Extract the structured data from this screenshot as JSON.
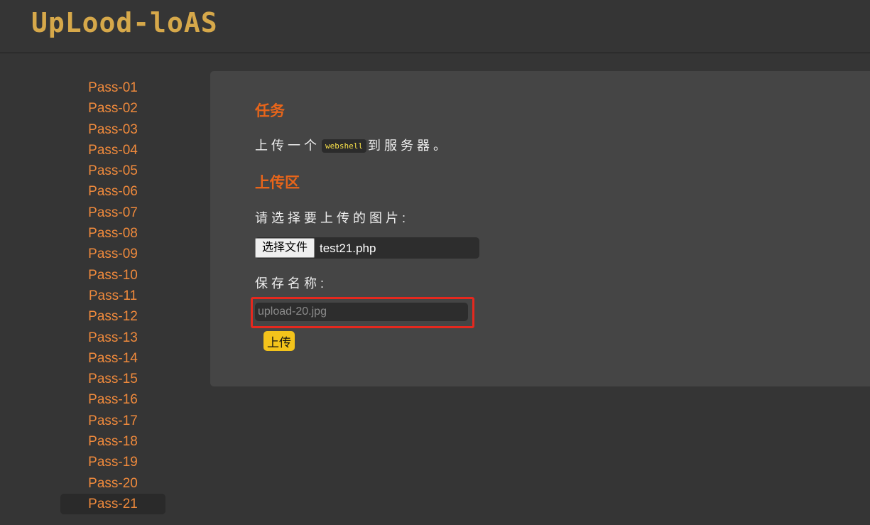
{
  "header": {
    "logo_text": "UpLood-loAS"
  },
  "sidebar": {
    "items": [
      {
        "label": "Pass-01"
      },
      {
        "label": "Pass-02"
      },
      {
        "label": "Pass-03"
      },
      {
        "label": "Pass-04"
      },
      {
        "label": "Pass-05"
      },
      {
        "label": "Pass-06"
      },
      {
        "label": "Pass-07"
      },
      {
        "label": "Pass-08"
      },
      {
        "label": "Pass-09"
      },
      {
        "label": "Pass-10"
      },
      {
        "label": "Pass-11"
      },
      {
        "label": "Pass-12"
      },
      {
        "label": "Pass-13"
      },
      {
        "label": "Pass-14"
      },
      {
        "label": "Pass-15"
      },
      {
        "label": "Pass-16"
      },
      {
        "label": "Pass-17"
      },
      {
        "label": "Pass-18"
      },
      {
        "label": "Pass-19"
      },
      {
        "label": "Pass-20"
      },
      {
        "label": "Pass-21"
      }
    ],
    "active": "Pass-21"
  },
  "task": {
    "title": "任务",
    "text_before": "上传一个",
    "code": "webshell",
    "text_after": "到服务器。"
  },
  "upload": {
    "title": "上传区",
    "choose_label": "请选择要上传的图片:",
    "file_button": "选择文件",
    "file_name": "test21.php",
    "save_name_label": "保存名称:",
    "save_name_placeholder": "upload-20.jpg",
    "submit_label": "上传"
  },
  "colors": {
    "accent_orange": "#e8651a",
    "nav_link": "#f08a3c",
    "highlight_border": "#e5281e",
    "submit_button": "#f3c31b"
  }
}
